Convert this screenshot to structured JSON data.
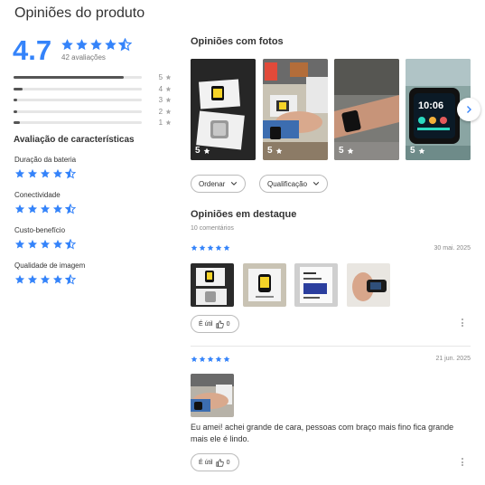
{
  "page_title": "Opiniões do produto",
  "summary": {
    "average": "4.7",
    "rating_stars": 4.5,
    "count_label": "42 avaliações"
  },
  "distribution": [
    {
      "stars": "5",
      "fraction": 0.86
    },
    {
      "stars": "4",
      "fraction": 0.07
    },
    {
      "stars": "3",
      "fraction": 0.02
    },
    {
      "stars": "2",
      "fraction": 0.0
    },
    {
      "stars": "1",
      "fraction": 0.05
    }
  ],
  "characteristics": {
    "title": "Avaliação de características",
    "items": [
      {
        "label": "Duração da bateria",
        "rating": 4.5
      },
      {
        "label": "Conectividade",
        "rating": 4.5
      },
      {
        "label": "Custo-benefício",
        "rating": 4.5
      },
      {
        "label": "Qualidade de imagem",
        "rating": 4.5
      }
    ]
  },
  "photos_section": {
    "title": "Opiniões com fotos",
    "photos": [
      {
        "rating": "5",
        "desc": "watch boxes"
      },
      {
        "rating": "5",
        "desc": "watch on wrist desk"
      },
      {
        "rating": "5",
        "desc": "watch on arm"
      },
      {
        "rating": "5",
        "desc": "watch screen closeup"
      }
    ]
  },
  "filters": {
    "sort_label": "Ordenar",
    "rating_label": "Qualificação"
  },
  "featured": {
    "title": "Opiniões em destaque",
    "count_label": "10 comentários",
    "reviews": [
      {
        "stars": 5,
        "date": "30 mai. 2025",
        "useful_label": "É útil",
        "useful_count": "0",
        "text": ""
      },
      {
        "stars": 5,
        "date": "21 jun. 2025",
        "useful_label": "É útil",
        "useful_count": "0",
        "text": "Eu amei! achei grande de cara, pessoas com braço mais fino fica grande mais ele é lindo."
      }
    ]
  },
  "colors": {
    "accent": "#3483fa",
    "text": "#333333",
    "muted": "#888888"
  },
  "icons": [
    "star-icon",
    "chevron-down-icon",
    "chevron-right-icon",
    "thumbs-up-icon",
    "kebab-icon"
  ]
}
